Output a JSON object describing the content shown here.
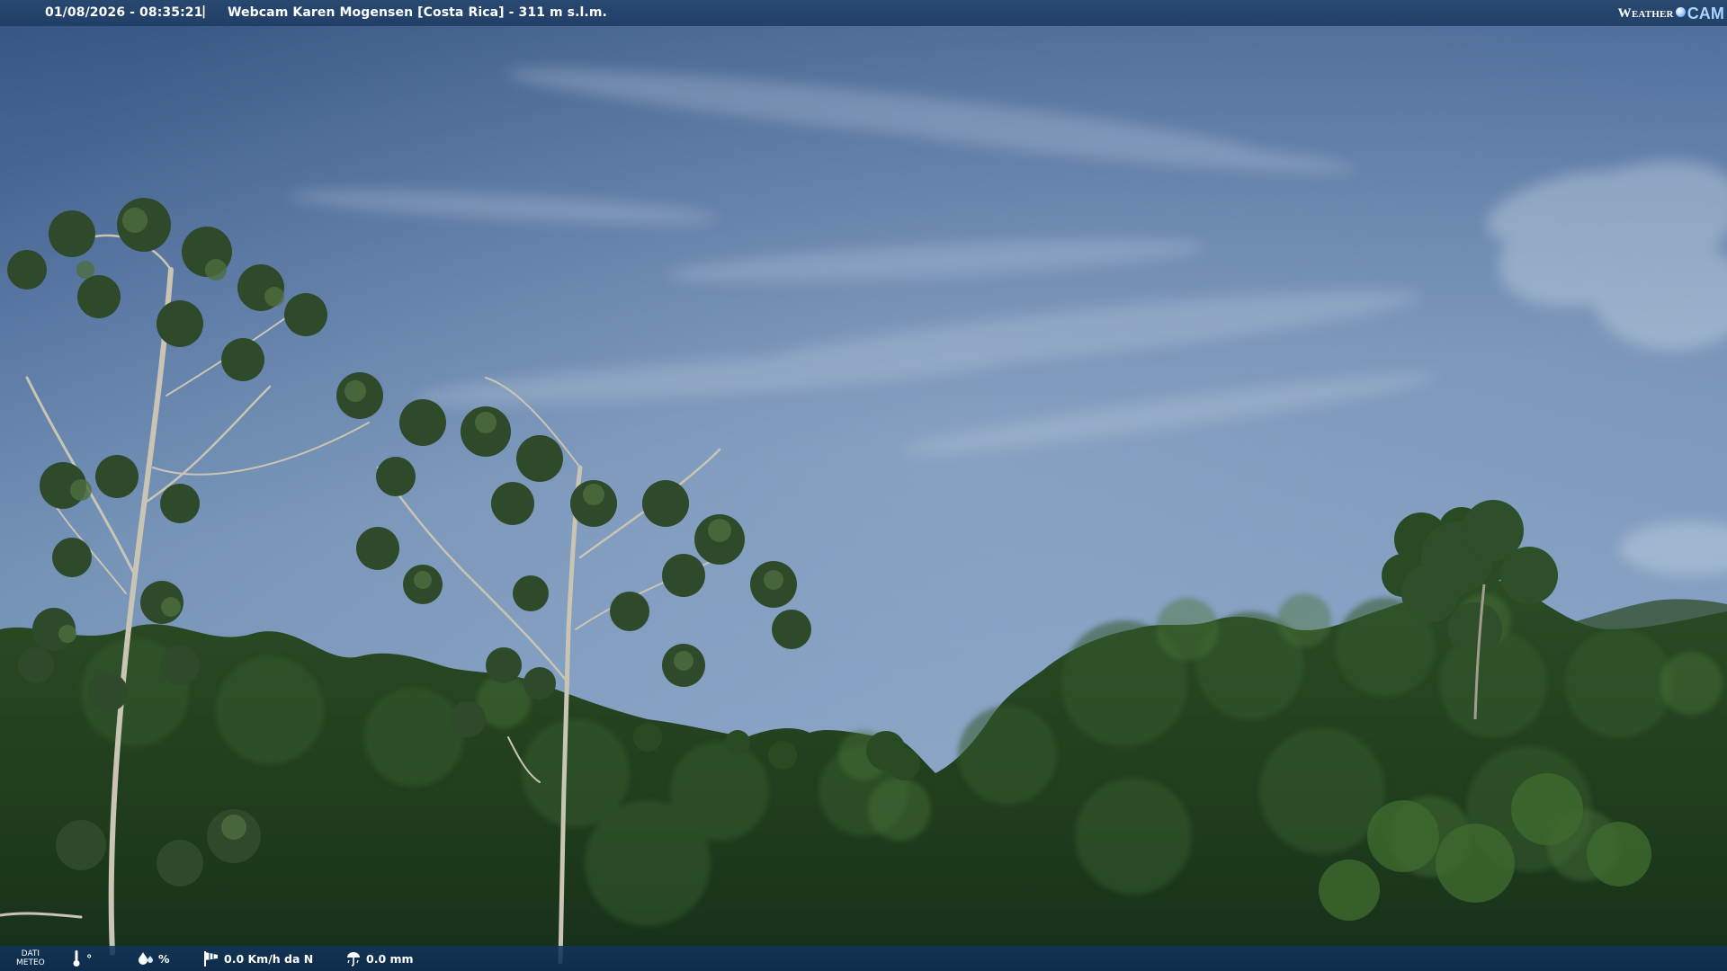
{
  "header": {
    "timestamp": "01/08/2026 - 08:35:21",
    "separator": "|",
    "camera_label": "Webcam Karen Mogensen [Costa Rica] - 311 m s.l.m.",
    "logo_weather": "Weather",
    "logo_cam": "CAM"
  },
  "footer": {
    "dati_line1": "DATI",
    "dati_line2": "METEO",
    "temperature_unit": "°",
    "humidity_unit": "%",
    "wind": "0.0 Km/h da N",
    "rain": "0.0 mm",
    "icons": [
      "thermometer-icon",
      "humidity-drops-icon",
      "wind-sock-icon",
      "rain-gauge-icon"
    ]
  },
  "colors": {
    "bar": "#284870",
    "footer_bar": "#12345c",
    "sky_top": "#3a5b85",
    "sky_mid": "#6d8cb2",
    "foliage": "#1f3a1c"
  }
}
